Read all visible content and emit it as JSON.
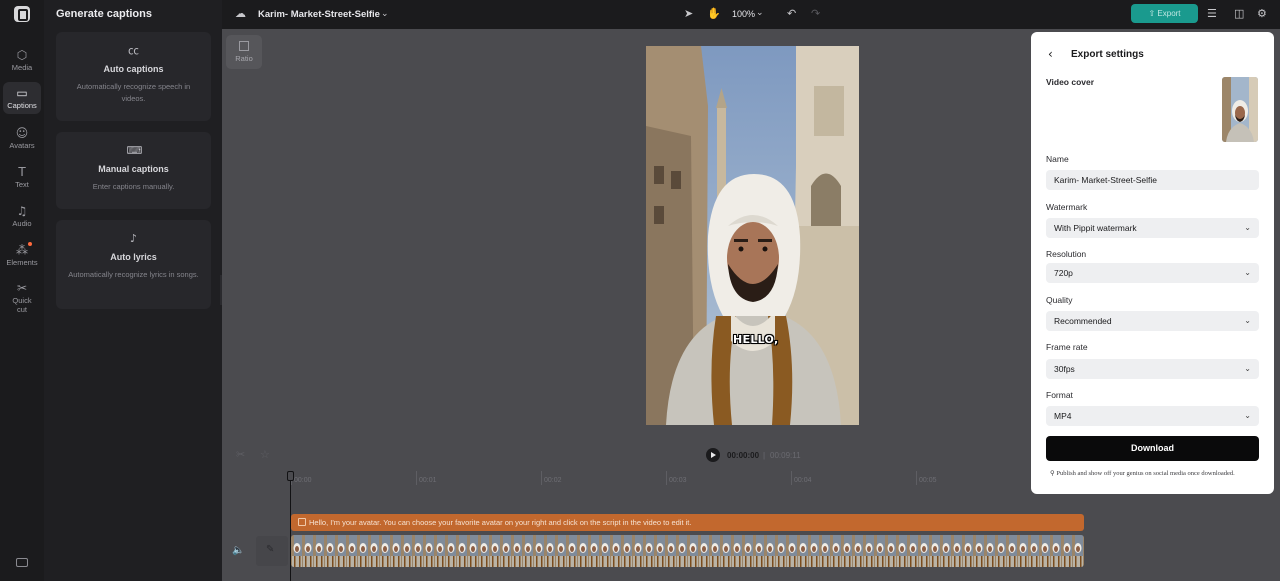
{
  "rail": {
    "items": [
      {
        "label": "Media",
        "icon": "media-icon"
      },
      {
        "label": "Captions",
        "icon": "captions-icon"
      },
      {
        "label": "Avatars",
        "icon": "avatar-icon"
      },
      {
        "label": "Text",
        "icon": "text-icon"
      },
      {
        "label": "Audio",
        "icon": "audio-icon"
      },
      {
        "label": "Elements",
        "icon": "elements-icon"
      },
      {
        "label": "Quick cut",
        "icon": "quick-cut-icon"
      }
    ],
    "active": "Captions"
  },
  "panel": {
    "title": "Generate captions",
    "cards": [
      {
        "title": "Auto captions",
        "desc": "Automatically recognize speech in videos.",
        "icon": "cc-icon"
      },
      {
        "title": "Manual captions",
        "desc": "Enter captions manually.",
        "icon": "keyboard-icon"
      },
      {
        "title": "Auto lyrics",
        "desc": "Automatically recognize lyrics in songs.",
        "icon": "lyrics-icon"
      }
    ]
  },
  "topbar": {
    "project_name": "Karim- Market-Street-Selfie",
    "zoom": "100%",
    "export_label": "Export"
  },
  "canvas": {
    "ratio_label": "Ratio",
    "subtitle_text": "HELLO,"
  },
  "playback": {
    "current_time": "00:00:00",
    "separator": "|",
    "total_time": "00:09:11"
  },
  "timeline": {
    "ticks": [
      "00:00",
      "00:01",
      "00:02",
      "00:03",
      "00:04",
      "00:05"
    ],
    "caption_text": "Hello, I'm your avatar. You can choose your favorite avatar on your right and click on the script in the video to edit it."
  },
  "export": {
    "title": "Export settings",
    "video_cover_label": "Video cover",
    "name_label": "Name",
    "name_value": "Karim- Market-Street-Selfie",
    "watermark_label": "Watermark",
    "watermark_value": "With Pippit watermark",
    "resolution_label": "Resolution",
    "resolution_value": "720p",
    "quality_label": "Quality",
    "quality_value": "Recommended",
    "framerate_label": "Frame rate",
    "framerate_value": "30fps",
    "format_label": "Format",
    "format_value": "MP4",
    "download_label": "Download",
    "note": "Publish and show off your genius on social media once downloaded."
  },
  "colors": {
    "accent": "#1a9a8e",
    "caption_track": "#c2682e",
    "download": "#0a0a0b"
  }
}
